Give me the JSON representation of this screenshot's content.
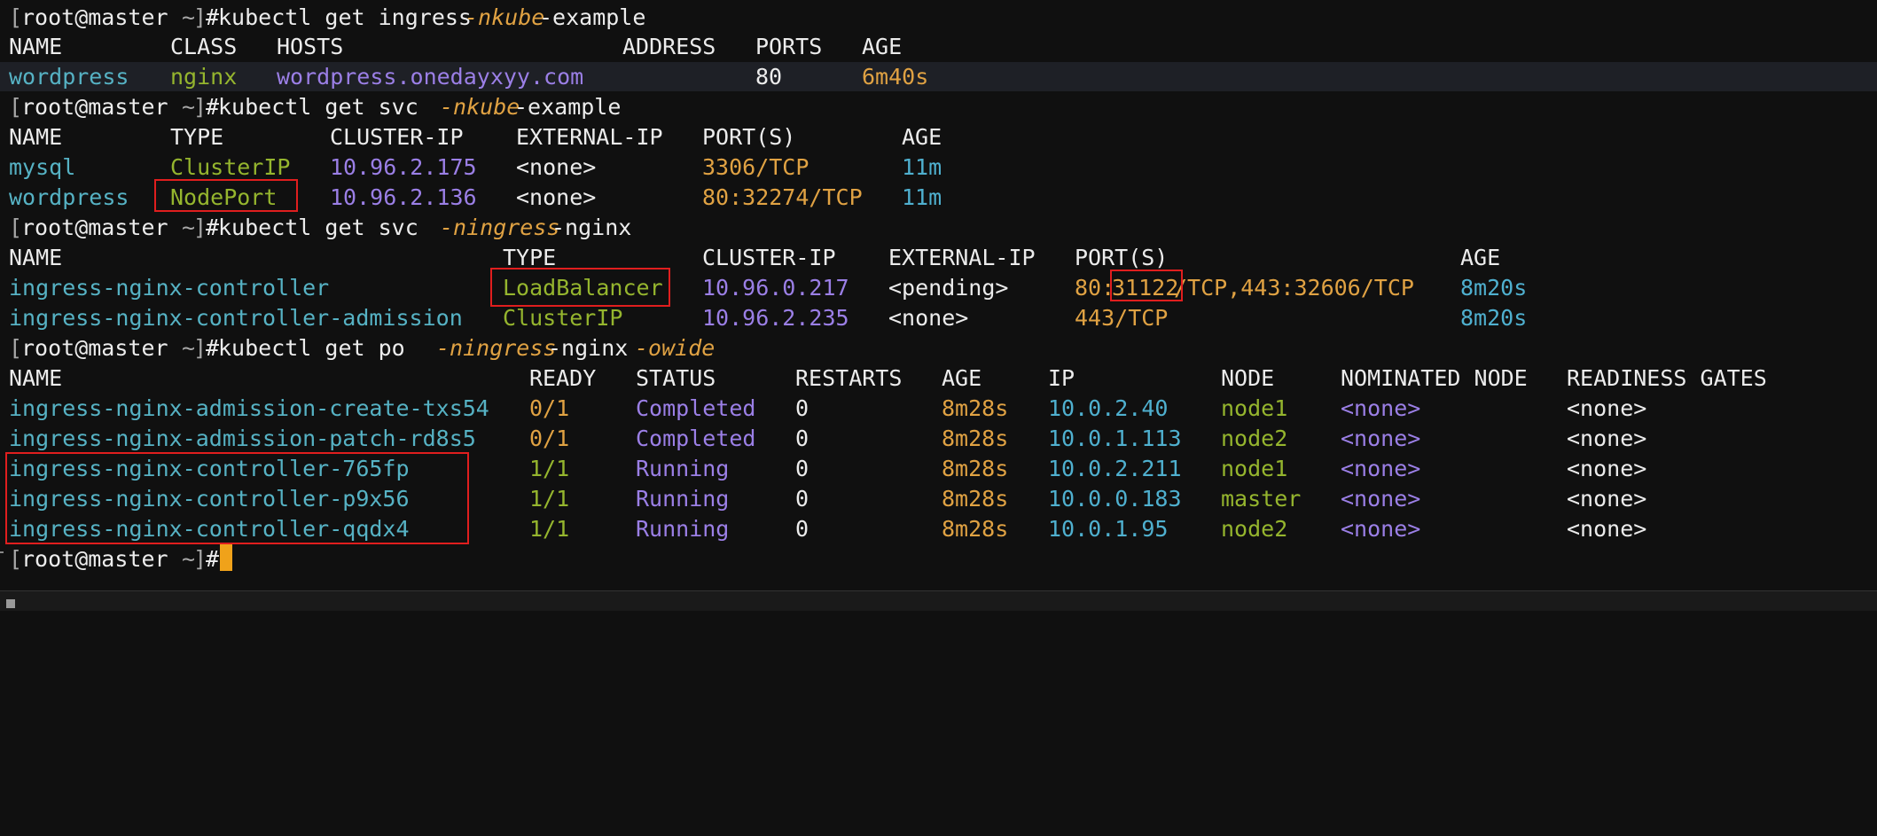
{
  "prompt": {
    "open": "[",
    "user_host": "root@master",
    "dir": " ~",
    "close": "]",
    "hash": "#"
  },
  "cmd1": {
    "base": "kubectl get ingress ",
    "flag": "-nkube",
    "rest": "-example"
  },
  "ingress": {
    "headers": [
      "NAME",
      "CLASS",
      "HOSTS",
      "ADDRESS",
      "PORTS",
      "AGE"
    ],
    "row": {
      "name": "wordpress",
      "class": "nginx",
      "hosts": "wordpress.onedayxyy.com",
      "address": "",
      "ports": "80",
      "age": "6m40s"
    }
  },
  "cmd2": {
    "base": "kubectl get svc ",
    "flag": "-nkube",
    "rest": "-example"
  },
  "svc1": {
    "headers": [
      "NAME",
      "TYPE",
      "CLUSTER-IP",
      "EXTERNAL-IP",
      "PORT(S)",
      "AGE"
    ],
    "rows": [
      {
        "name": "mysql",
        "type": "ClusterIP",
        "ip": "10.96.2.175",
        "ext": "<none>",
        "ports": "3306/TCP",
        "age": "11m"
      },
      {
        "name": "wordpress",
        "type": "NodePort",
        "ip": "10.96.2.136",
        "ext": "<none>",
        "ports": "80:32274/TCP",
        "age": "11m"
      }
    ]
  },
  "cmd3": {
    "base": "kubectl get svc ",
    "flag": "-ningress",
    "rest": "-nginx"
  },
  "svc2": {
    "headers": [
      "NAME",
      "TYPE",
      "CLUSTER-IP",
      "EXTERNAL-IP",
      "PORT(S)",
      "AGE"
    ],
    "rows": [
      {
        "name": "ingress-nginx-controller",
        "type": "LoadBalancer",
        "ip": "10.96.0.217",
        "ext": "<pending>",
        "ports_a": "80:",
        "ports_b": "31122",
        "ports_c": "/TCP,443:32606/TCP",
        "age": "8m20s"
      },
      {
        "name": "ingress-nginx-controller-admission",
        "type": "ClusterIP",
        "ip": "10.96.2.235",
        "ext": "<none>",
        "ports_a": "443/TCP",
        "ports_b": "",
        "ports_c": "",
        "age": "8m20s"
      }
    ]
  },
  "cmd4": {
    "base": "kubectl get po  ",
    "flag1": "-ningress",
    "mid": "-nginx ",
    "flag2": "-owide"
  },
  "pods": {
    "headers": [
      "NAME",
      "READY",
      "STATUS",
      "RESTARTS",
      "AGE",
      "IP",
      "NODE",
      "NOMINATED NODE",
      "READINESS GATES"
    ],
    "rows": [
      {
        "name": "ingress-nginx-admission-create-txs54",
        "ready": "0/1",
        "status": "Completed",
        "restarts": "0",
        "age": "8m28s",
        "ip": "10.0.2.40",
        "node": "node1",
        "nominated": "<none>",
        "gates": "<none>"
      },
      {
        "name": "ingress-nginx-admission-patch-rd8s5",
        "ready": "0/1",
        "status": "Completed",
        "restarts": "0",
        "age": "8m28s",
        "ip": "10.0.1.113",
        "node": "node2",
        "nominated": "<none>",
        "gates": "<none>"
      },
      {
        "name": "ingress-nginx-controller-765fp",
        "ready": "1/1",
        "status": "Running",
        "restarts": "0",
        "age": "8m28s",
        "ip": "10.0.2.211",
        "node": "node1",
        "nominated": "<none>",
        "gates": "<none>"
      },
      {
        "name": "ingress-nginx-controller-p9x56",
        "ready": "1/1",
        "status": "Running",
        "restarts": "0",
        "age": "8m28s",
        "ip": "10.0.0.183",
        "node": "master",
        "nominated": "<none>",
        "gates": "<none>"
      },
      {
        "name": "ingress-nginx-controller-qqdx4",
        "ready": "1/1",
        "status": "Running",
        "restarts": "0",
        "age": "8m28s",
        "ip": "10.0.1.95",
        "node": "node2",
        "nominated": "<none>",
        "gates": "<none>"
      }
    ]
  },
  "colors": {
    "background": "#101010",
    "prompt": "#a8a8a8",
    "flag": "#e0a243",
    "name": "#56b2c4",
    "type": "#95b52e",
    "ip": "#9b7fe6",
    "age": "#4fb0cf",
    "highlight_box": "#e01e1e",
    "cursor": "#f0a21a"
  }
}
